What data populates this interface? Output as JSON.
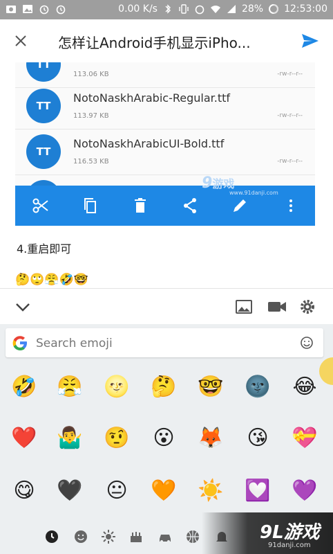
{
  "status_bar": {
    "speed": "0.00 K/s",
    "battery": "28%",
    "time": "12:53:00"
  },
  "appbar": {
    "title": "怎样让Android手机显示iPho..."
  },
  "screenshot": {
    "files": [
      {
        "name": "",
        "size": "113.06 KB",
        "perm": "-rw-r--r--",
        "icon": "TT"
      },
      {
        "name": "NotoNaskhArabic-Regular.ttf",
        "size": "113.97 KB",
        "perm": "-rw-r--r--",
        "icon": "TT"
      },
      {
        "name": "NotoNaskhArabicUI-Bold.ttf",
        "size": "116.53 KB",
        "perm": "-rw-r--r--",
        "icon": "TT"
      }
    ],
    "watermark": {
      "logo": "9",
      "brand": "游戏",
      "url": "www.91danji.com"
    }
  },
  "post": {
    "step_text": "4.重启即可",
    "inline_emojis": "🤔🙄😤🤣🤓"
  },
  "emoji_keyboard": {
    "search_placeholder": "Search emoji",
    "rows": [
      [
        "🤣",
        "😤",
        "🌝",
        "🤔",
        "🤓",
        "🌚",
        "😂"
      ],
      [
        "❤️",
        "🤷‍♂️",
        "🤨",
        "😮",
        "🦊",
        "😘",
        "💝"
      ],
      [
        "😋",
        "🖤",
        "😐",
        "🧡",
        "☀️",
        "💟",
        "💜"
      ]
    ]
  },
  "corner_watermark": {
    "brand": "9L游戏",
    "url": "91danji.com"
  },
  "colors": {
    "accent": "#1e88e5",
    "send": "#1e88e5",
    "status_bar": "#9e9e9e",
    "file_icon": "#1e7fd4"
  }
}
